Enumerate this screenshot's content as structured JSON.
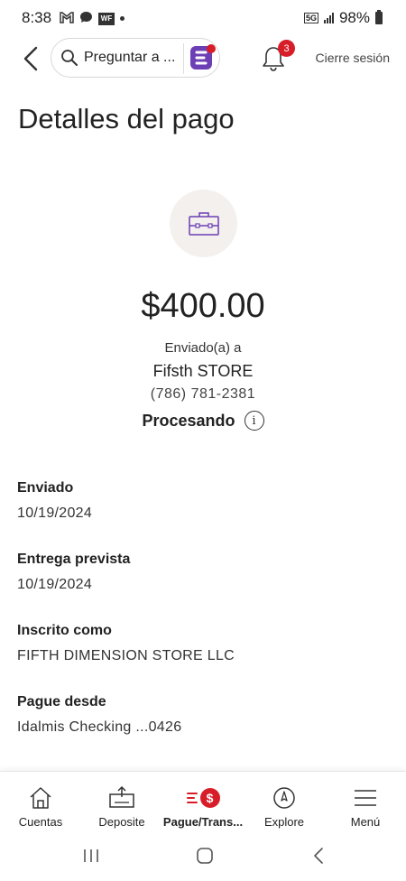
{
  "status_bar": {
    "time": "8:38",
    "network": "5G",
    "battery": "98%"
  },
  "header": {
    "search_placeholder": "Preguntar a ...",
    "notification_count": "3",
    "signout_label": "Cierre sesión"
  },
  "page": {
    "title": "Detalles del pago",
    "amount": "$400.00",
    "sent_to_label": "Enviado(a) a",
    "payee_name": "Fifsth STORE",
    "payee_phone": "(786) 781-2381",
    "status": "Procesando"
  },
  "details": [
    {
      "label": "Enviado",
      "value": "10/19/2024"
    },
    {
      "label": "Entrega prevista",
      "value": "10/19/2024"
    },
    {
      "label": "Inscrito como",
      "value": "FIFTH DIMENSION STORE LLC"
    },
    {
      "label": "Pague desde",
      "value": "Idalmis Checking ...0426"
    }
  ],
  "bottom_nav": {
    "items": [
      {
        "label": "Cuentas",
        "icon": "home-icon"
      },
      {
        "label": "Deposite",
        "icon": "deposit-icon"
      },
      {
        "label": "Pague/Trans...",
        "icon": "pay-transfer-icon",
        "active": true
      },
      {
        "label": "Explore",
        "icon": "compass-icon"
      },
      {
        "label": "Menú",
        "icon": "menu-icon"
      }
    ]
  },
  "colors": {
    "brand_red": "#d71e28",
    "brand_purple": "#6c3fb5",
    "icon_circle_bg": "#f4f0ed"
  }
}
